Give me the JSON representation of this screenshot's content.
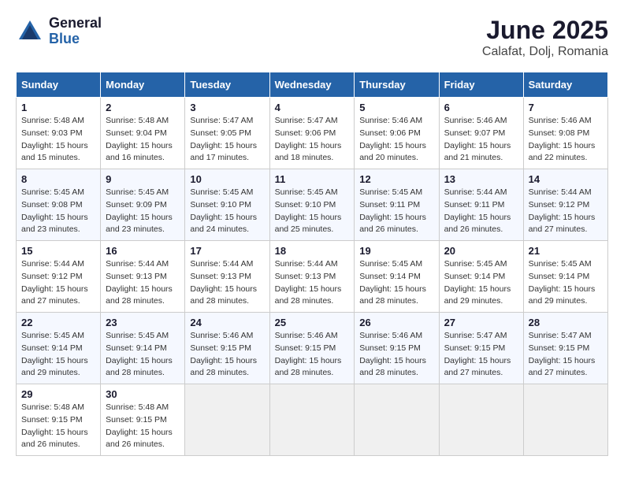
{
  "logo": {
    "general": "General",
    "blue": "Blue"
  },
  "header": {
    "month": "June 2025",
    "location": "Calafat, Dolj, Romania"
  },
  "weekdays": [
    "Sunday",
    "Monday",
    "Tuesday",
    "Wednesday",
    "Thursday",
    "Friday",
    "Saturday"
  ],
  "weeks": [
    [
      {
        "day": "1",
        "sunrise": "Sunrise: 5:48 AM",
        "sunset": "Sunset: 9:03 PM",
        "daylight": "Daylight: 15 hours and 15 minutes."
      },
      {
        "day": "2",
        "sunrise": "Sunrise: 5:48 AM",
        "sunset": "Sunset: 9:04 PM",
        "daylight": "Daylight: 15 hours and 16 minutes."
      },
      {
        "day": "3",
        "sunrise": "Sunrise: 5:47 AM",
        "sunset": "Sunset: 9:05 PM",
        "daylight": "Daylight: 15 hours and 17 minutes."
      },
      {
        "day": "4",
        "sunrise": "Sunrise: 5:47 AM",
        "sunset": "Sunset: 9:06 PM",
        "daylight": "Daylight: 15 hours and 18 minutes."
      },
      {
        "day": "5",
        "sunrise": "Sunrise: 5:46 AM",
        "sunset": "Sunset: 9:06 PM",
        "daylight": "Daylight: 15 hours and 20 minutes."
      },
      {
        "day": "6",
        "sunrise": "Sunrise: 5:46 AM",
        "sunset": "Sunset: 9:07 PM",
        "daylight": "Daylight: 15 hours and 21 minutes."
      },
      {
        "day": "7",
        "sunrise": "Sunrise: 5:46 AM",
        "sunset": "Sunset: 9:08 PM",
        "daylight": "Daylight: 15 hours and 22 minutes."
      }
    ],
    [
      {
        "day": "8",
        "sunrise": "Sunrise: 5:45 AM",
        "sunset": "Sunset: 9:08 PM",
        "daylight": "Daylight: 15 hours and 23 minutes."
      },
      {
        "day": "9",
        "sunrise": "Sunrise: 5:45 AM",
        "sunset": "Sunset: 9:09 PM",
        "daylight": "Daylight: 15 hours and 23 minutes."
      },
      {
        "day": "10",
        "sunrise": "Sunrise: 5:45 AM",
        "sunset": "Sunset: 9:10 PM",
        "daylight": "Daylight: 15 hours and 24 minutes."
      },
      {
        "day": "11",
        "sunrise": "Sunrise: 5:45 AM",
        "sunset": "Sunset: 9:10 PM",
        "daylight": "Daylight: 15 hours and 25 minutes."
      },
      {
        "day": "12",
        "sunrise": "Sunrise: 5:45 AM",
        "sunset": "Sunset: 9:11 PM",
        "daylight": "Daylight: 15 hours and 26 minutes."
      },
      {
        "day": "13",
        "sunrise": "Sunrise: 5:44 AM",
        "sunset": "Sunset: 9:11 PM",
        "daylight": "Daylight: 15 hours and 26 minutes."
      },
      {
        "day": "14",
        "sunrise": "Sunrise: 5:44 AM",
        "sunset": "Sunset: 9:12 PM",
        "daylight": "Daylight: 15 hours and 27 minutes."
      }
    ],
    [
      {
        "day": "15",
        "sunrise": "Sunrise: 5:44 AM",
        "sunset": "Sunset: 9:12 PM",
        "daylight": "Daylight: 15 hours and 27 minutes."
      },
      {
        "day": "16",
        "sunrise": "Sunrise: 5:44 AM",
        "sunset": "Sunset: 9:13 PM",
        "daylight": "Daylight: 15 hours and 28 minutes."
      },
      {
        "day": "17",
        "sunrise": "Sunrise: 5:44 AM",
        "sunset": "Sunset: 9:13 PM",
        "daylight": "Daylight: 15 hours and 28 minutes."
      },
      {
        "day": "18",
        "sunrise": "Sunrise: 5:44 AM",
        "sunset": "Sunset: 9:13 PM",
        "daylight": "Daylight: 15 hours and 28 minutes."
      },
      {
        "day": "19",
        "sunrise": "Sunrise: 5:45 AM",
        "sunset": "Sunset: 9:14 PM",
        "daylight": "Daylight: 15 hours and 28 minutes."
      },
      {
        "day": "20",
        "sunrise": "Sunrise: 5:45 AM",
        "sunset": "Sunset: 9:14 PM",
        "daylight": "Daylight: 15 hours and 29 minutes."
      },
      {
        "day": "21",
        "sunrise": "Sunrise: 5:45 AM",
        "sunset": "Sunset: 9:14 PM",
        "daylight": "Daylight: 15 hours and 29 minutes."
      }
    ],
    [
      {
        "day": "22",
        "sunrise": "Sunrise: 5:45 AM",
        "sunset": "Sunset: 9:14 PM",
        "daylight": "Daylight: 15 hours and 29 minutes."
      },
      {
        "day": "23",
        "sunrise": "Sunrise: 5:45 AM",
        "sunset": "Sunset: 9:14 PM",
        "daylight": "Daylight: 15 hours and 28 minutes."
      },
      {
        "day": "24",
        "sunrise": "Sunrise: 5:46 AM",
        "sunset": "Sunset: 9:15 PM",
        "daylight": "Daylight: 15 hours and 28 minutes."
      },
      {
        "day": "25",
        "sunrise": "Sunrise: 5:46 AM",
        "sunset": "Sunset: 9:15 PM",
        "daylight": "Daylight: 15 hours and 28 minutes."
      },
      {
        "day": "26",
        "sunrise": "Sunrise: 5:46 AM",
        "sunset": "Sunset: 9:15 PM",
        "daylight": "Daylight: 15 hours and 28 minutes."
      },
      {
        "day": "27",
        "sunrise": "Sunrise: 5:47 AM",
        "sunset": "Sunset: 9:15 PM",
        "daylight": "Daylight: 15 hours and 27 minutes."
      },
      {
        "day": "28",
        "sunrise": "Sunrise: 5:47 AM",
        "sunset": "Sunset: 9:15 PM",
        "daylight": "Daylight: 15 hours and 27 minutes."
      }
    ],
    [
      {
        "day": "29",
        "sunrise": "Sunrise: 5:48 AM",
        "sunset": "Sunset: 9:15 PM",
        "daylight": "Daylight: 15 hours and 26 minutes."
      },
      {
        "day": "30",
        "sunrise": "Sunrise: 5:48 AM",
        "sunset": "Sunset: 9:15 PM",
        "daylight": "Daylight: 15 hours and 26 minutes."
      },
      null,
      null,
      null,
      null,
      null
    ]
  ]
}
